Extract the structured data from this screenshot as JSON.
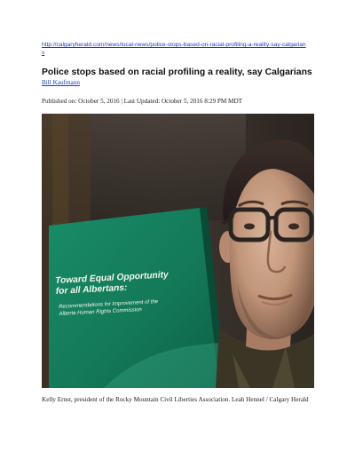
{
  "article": {
    "url": "http://calgaryherald.com/news/local-news/police-stops-based-on-racial-profiling-a-reality-say-calgarians",
    "headline": "Police stops based on racial profiling a reality, say Calgarians",
    "author": "Bill Kaufmann",
    "published_line": "Published on: October 5, 2016 | Last Updated: October 5, 2016 8:29 PM MDT",
    "caption": "Kelly Ernst, president of the Rocky Mountain Civil Liberties Association. Leah Hennel / Calgary Herald"
  },
  "photo": {
    "book_title": "Toward Equal Opportunity for all Albertans:",
    "book_subtitle": "Recommendations for Improvement of the Alberta Human Rights Commission"
  }
}
